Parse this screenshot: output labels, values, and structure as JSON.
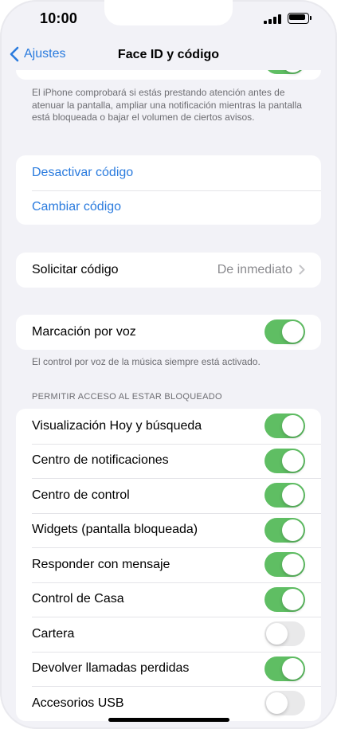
{
  "status_bar": {
    "time": "10:00"
  },
  "nav": {
    "back_label": "Ajustes",
    "title": "Face ID y código"
  },
  "attention": {
    "toggle_on": true,
    "footnote": "El iPhone comprobará si estás prestando atención antes de atenuar la pantalla, ampliar una notificación mientras la pantalla está bloqueada o bajar el volumen de ciertos avisos."
  },
  "passcode_actions": [
    {
      "label": "Desactivar código"
    },
    {
      "label": "Cambiar código"
    }
  ],
  "require": {
    "label": "Solicitar código",
    "value": "De inmediato"
  },
  "voice_dial": {
    "label": "Marcación por voz",
    "on": true,
    "footnote": "El control por voz de la música siempre está activado."
  },
  "locked_access": {
    "header": "PERMITIR ACCESO AL ESTAR BLOQUEADO",
    "items": [
      {
        "label": "Visualización Hoy y búsqueda",
        "on": true
      },
      {
        "label": "Centro de notificaciones",
        "on": true
      },
      {
        "label": "Centro de control",
        "on": true
      },
      {
        "label": "Widgets (pantalla bloqueada)",
        "on": true
      },
      {
        "label": "Responder con mensaje",
        "on": true
      },
      {
        "label": "Control de Casa",
        "on": true
      },
      {
        "label": "Cartera",
        "on": false
      },
      {
        "label": "Devolver llamadas perdidas",
        "on": true
      },
      {
        "label": "Accesorios USB",
        "on": false
      }
    ]
  },
  "colors": {
    "accent": "#2a7bde",
    "toggle_on": "#5fbe63",
    "background": "#f2f2f7"
  }
}
